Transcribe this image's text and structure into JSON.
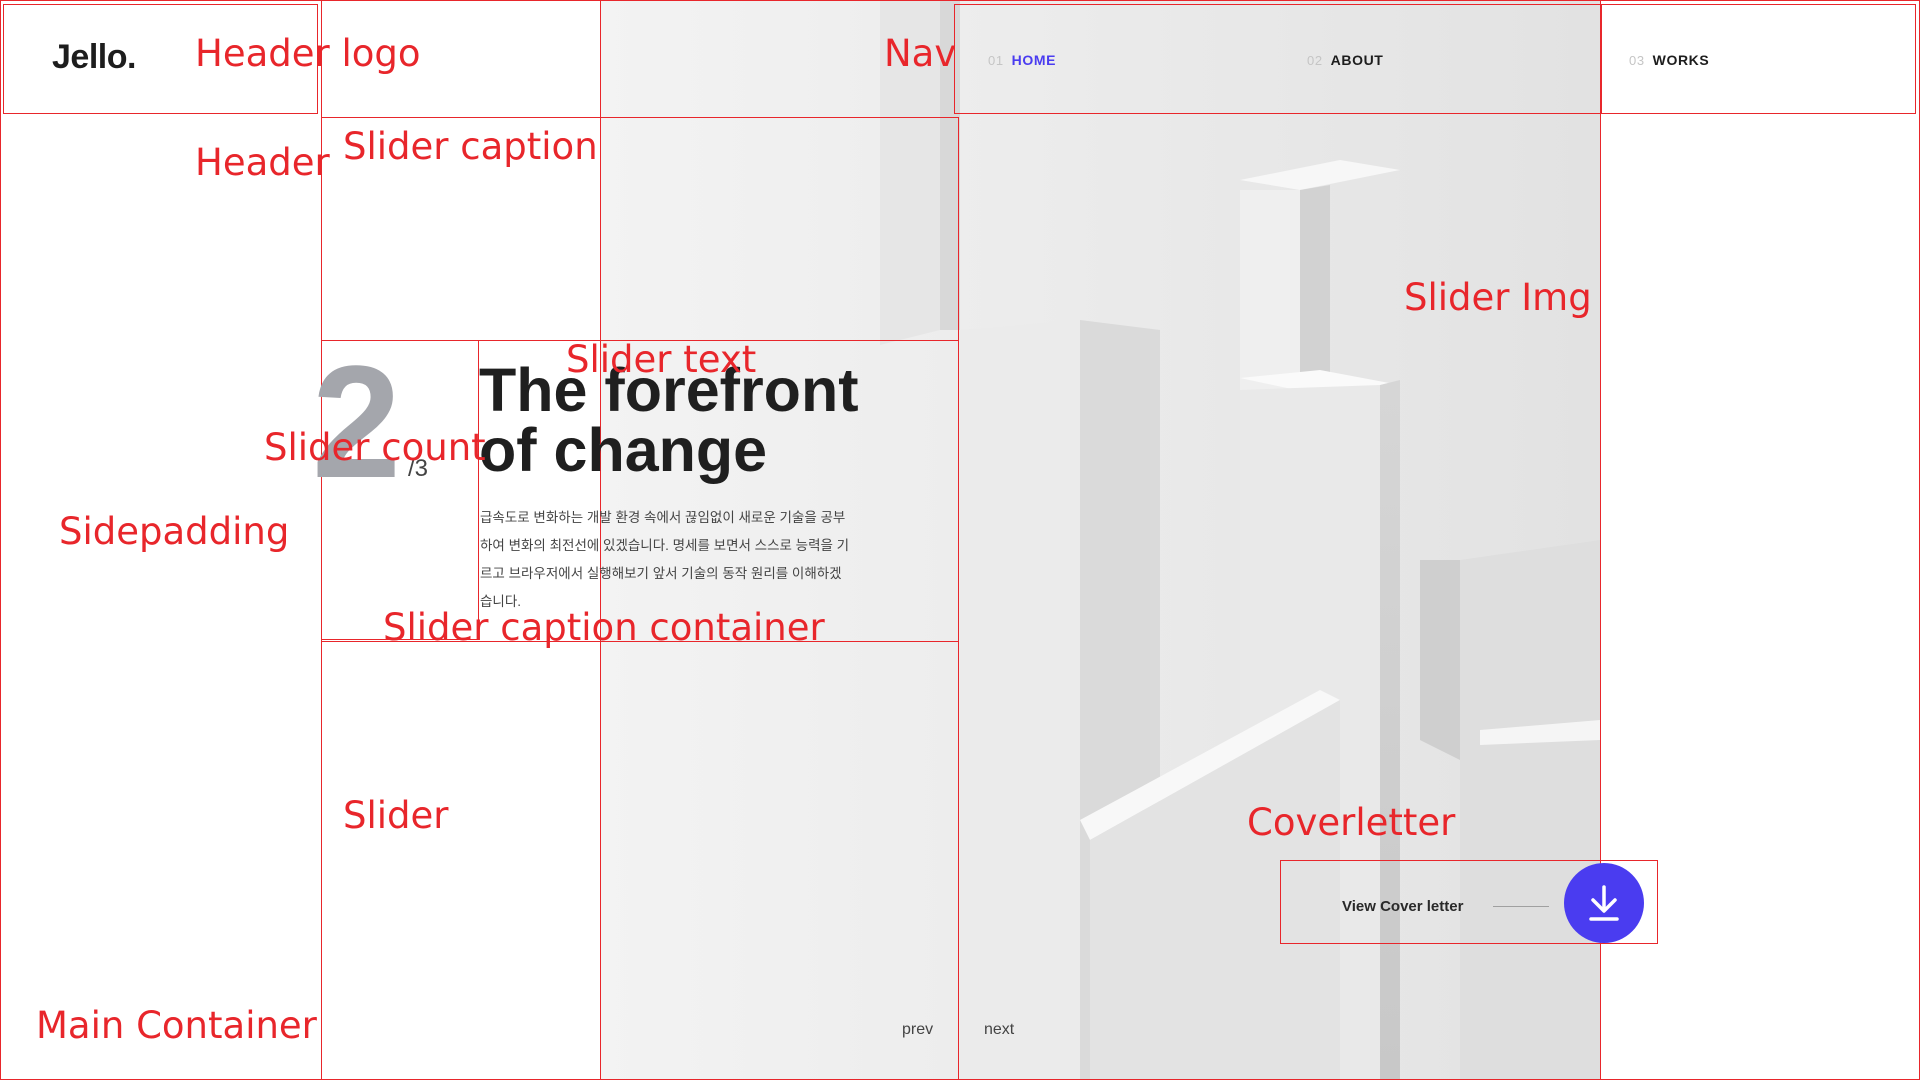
{
  "header": {
    "logo": "Jello."
  },
  "nav": {
    "items": [
      {
        "num": "01",
        "label": "HOME",
        "active": true
      },
      {
        "num": "02",
        "label": "ABOUT",
        "active": false
      },
      {
        "num": "03",
        "label": "WORKS",
        "active": false
      }
    ]
  },
  "slider": {
    "count_current": "2",
    "count_total": "/3",
    "title_line1": "The forefront",
    "title_line2": "of change",
    "description": "급속도로 변화하는 개발 환경 속에서 끊임없이 새로운 기술을 공부하여 변화의 최전선에 있겠습니다. 명세를 보면서 스스로 능력을 기르고 브라우저에서 실행해보기 앞서 기술의 동작 원리를 이해하겠습니다.",
    "prev_label": "prev",
    "next_label": "next"
  },
  "coverletter": {
    "label": "View Cover letter",
    "icon": "download-icon"
  },
  "annotations": {
    "header_logo": "Header logo",
    "nav": "Nav",
    "header": "Header",
    "slider_caption": "Slider caption",
    "slider_img": "Slider Img",
    "slider_text": "Slider text",
    "slider_count": "Slider count",
    "sidepadding": "Sidepadding",
    "slider_caption_container": "Slider caption container",
    "slider": "Slider",
    "coverletter": "Coverletter",
    "main_container": "Main Container"
  },
  "colors": {
    "accent": "#4a3cf0",
    "annotation": "#e8262b",
    "count": "#a4a6ac"
  }
}
